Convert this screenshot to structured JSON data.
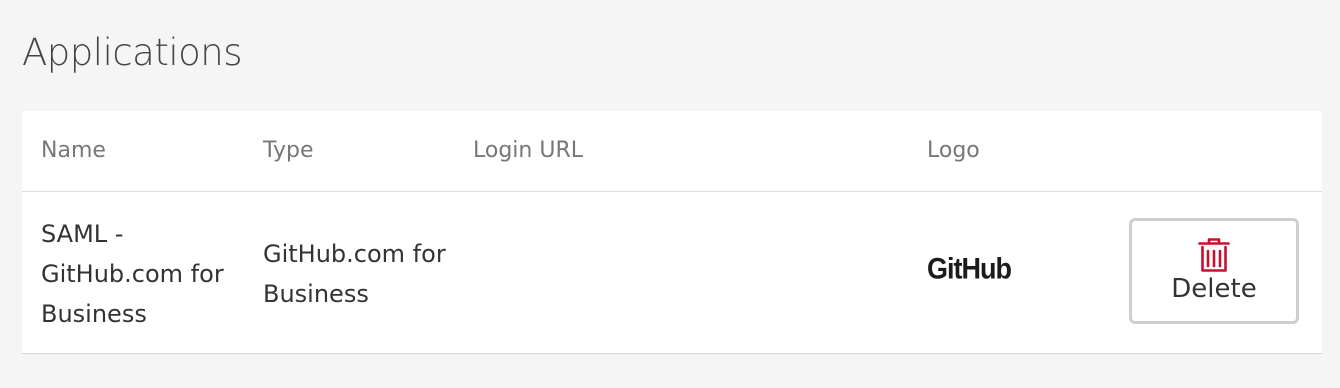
{
  "page": {
    "title": "Applications"
  },
  "table": {
    "columns": [
      "Name",
      "Type",
      "Login URL",
      "Logo"
    ],
    "rows": [
      {
        "name": "SAML - GitHub.com for Business",
        "type": "GitHub.com for Business",
        "login_url": "",
        "logo_text": "GitHub",
        "action_label": "Delete",
        "action_icon": "trash-icon"
      }
    ]
  },
  "colors": {
    "background": "#f5f5f5",
    "card": "#ffffff",
    "danger_icon": "#c8102e",
    "header_text": "#777777"
  }
}
